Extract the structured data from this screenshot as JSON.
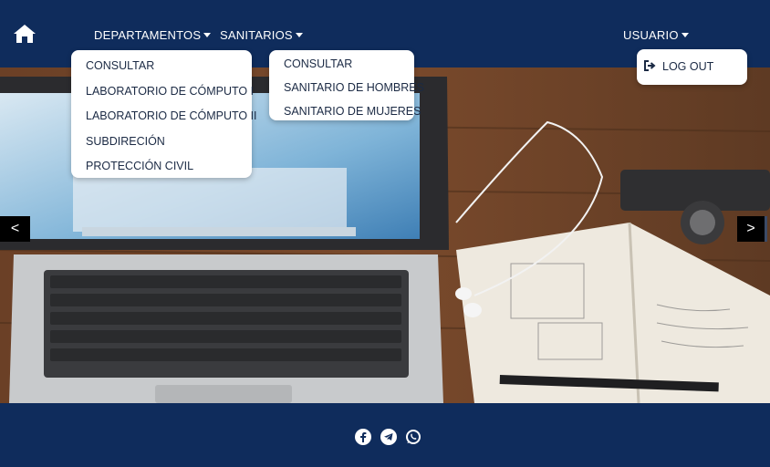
{
  "navbar": {
    "home_icon": "home-icon",
    "departamentos_label": "DEPARTAMENTOS",
    "sanitarios_label": "SANITARIOS",
    "usuario_label": "USUARIO",
    "background": "#0f2c5c"
  },
  "dropdowns": {
    "departamentos": [
      "CONSULTAR",
      "LABORATORIO DE CÓMPUTO I",
      "LABORATORIO DE CÓMPUTO II",
      "SUBDIRECIÓN",
      "PROTECCIÓN CIVIL"
    ],
    "sanitarios": [
      "CONSULTAR",
      "SANITARIO DE HOMBRES",
      "SANITARIO DE MUJERES"
    ],
    "usuario": {
      "logout_label": "LOG OUT",
      "logout_icon": "logout-icon"
    }
  },
  "carousel": {
    "prev_label": "<",
    "next_label": ">"
  },
  "footer": {
    "social_icons": [
      "facebook-icon",
      "telegram-icon",
      "whatsapp-icon"
    ],
    "background": "#0f2c5c"
  }
}
